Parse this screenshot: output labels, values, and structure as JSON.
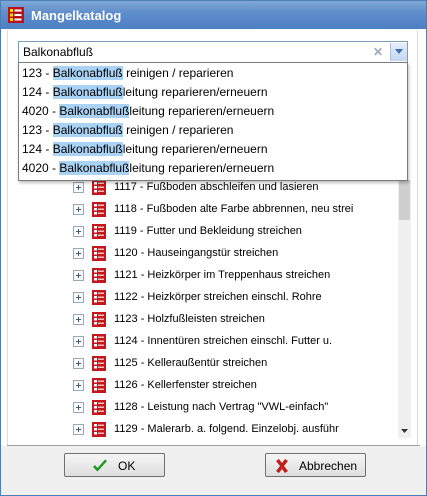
{
  "window": {
    "title": "Mangelkatalog",
    "title_icon": "red-catalog-icon"
  },
  "search": {
    "value": "Balkonabfluß",
    "clear_icon": "clear-x-icon",
    "dropdown_icon": "chevron-down-icon"
  },
  "suggestions": [
    {
      "prefix": "123 - ",
      "match": "Balkonabfluß",
      "suffix": " reinigen / reparieren"
    },
    {
      "prefix": "124 - ",
      "match": "Balkonabfluß",
      "suffix": "leitung reparieren/erneuern"
    },
    {
      "prefix": "4020 - ",
      "match": "Balkonabfluß",
      "suffix": "leitung reparieren/erneuern"
    },
    {
      "prefix": "123 - ",
      "match": "Balkonabfluß",
      "suffix": " reinigen / reparieren"
    },
    {
      "prefix": "124 - ",
      "match": "Balkonabfluß",
      "suffix": "leitung reparieren/erneuern"
    },
    {
      "prefix": "4020 - ",
      "match": "Balkonabfluß",
      "suffix": "leitung reparieren/erneuern"
    }
  ],
  "tree_items": [
    "1117 - Fußboden abschleifen und lasieren",
    "1118 - Fußboden alte Farbe abbrennen, neu strei",
    "1119 - Futter und Bekleidung streichen",
    "1120 - Hauseingangstür streichen",
    "1121 - Heizkörper im Treppenhaus streichen",
    "1122 - Heizkörper streichen einschl. Rohre",
    "1123 - Holzfußleisten streichen",
    "1124 - Innentüren streichen einschl. Futter u.",
    "1125 - Kelleraußentür streichen",
    "1126 - Kellerfenster streichen",
    "1128 - Leistung nach Vertrag \"VWL-einfach\"",
    "1129 - Malerarb. a. folgend. Einzelobj. ausführ"
  ],
  "buttons": {
    "ok_label": "OK",
    "cancel_label": "Abbrechen"
  },
  "colors": {
    "titlebar": "#5d8ccc",
    "highlight": "#a9d2f5",
    "ok_check": "#1f9a1f",
    "cancel_x": "#c0201a",
    "catalog_icon": "#c4161c"
  }
}
